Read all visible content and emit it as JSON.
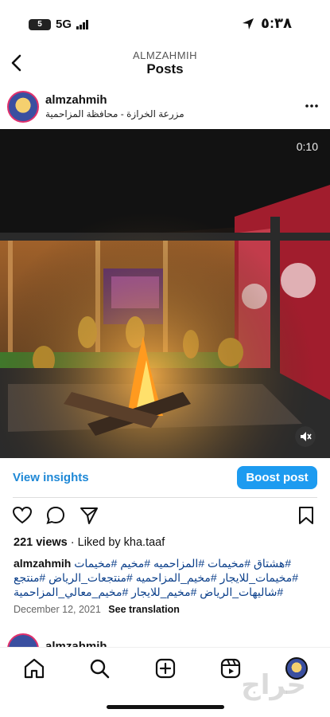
{
  "status": {
    "battery": "5",
    "network": "5G",
    "time": "٥:٣٨"
  },
  "header": {
    "account": "ALMZAHMIH",
    "title": "Posts"
  },
  "post": {
    "username": "almzahmih",
    "location": "مزرعة الخرازة - محافظة المزاحمية",
    "video_time": "0:10",
    "insights_label": "View insights",
    "boost_label": "Boost post",
    "views": "221 views",
    "liked_by": "Liked by kha.taaf",
    "caption_user": "almzahmih",
    "caption_lines": [
      "#هشتاق #مخيمات #المزاحميه #مخيم #مخيمات",
      "#مخيمات_للايجار #مخيم_المزاحميه #منتجعات_الرياض #منتجع",
      "#شاليهات_الرياض #مخيم_للايجار #مخيم_معالي_المزاحمية"
    ],
    "date": "December 12, 2021",
    "see_translation": "See translation"
  },
  "next_post": {
    "username": "almzahmih"
  },
  "watermark": "حراج",
  "icons": {
    "back": "chevron-left-icon",
    "more": "more-horizontal-icon",
    "like": "heart-icon",
    "comment": "comment-icon",
    "share": "send-icon",
    "save": "bookmark-icon",
    "mute": "speaker-muted-icon",
    "home": "home-icon",
    "search": "search-icon",
    "create": "plus-square-icon",
    "reels": "reels-icon",
    "profile": "profile-avatar"
  },
  "colors": {
    "accent": "#1d9bf0",
    "link": "#1e88d6",
    "hashtag": "#0b3f8a"
  }
}
